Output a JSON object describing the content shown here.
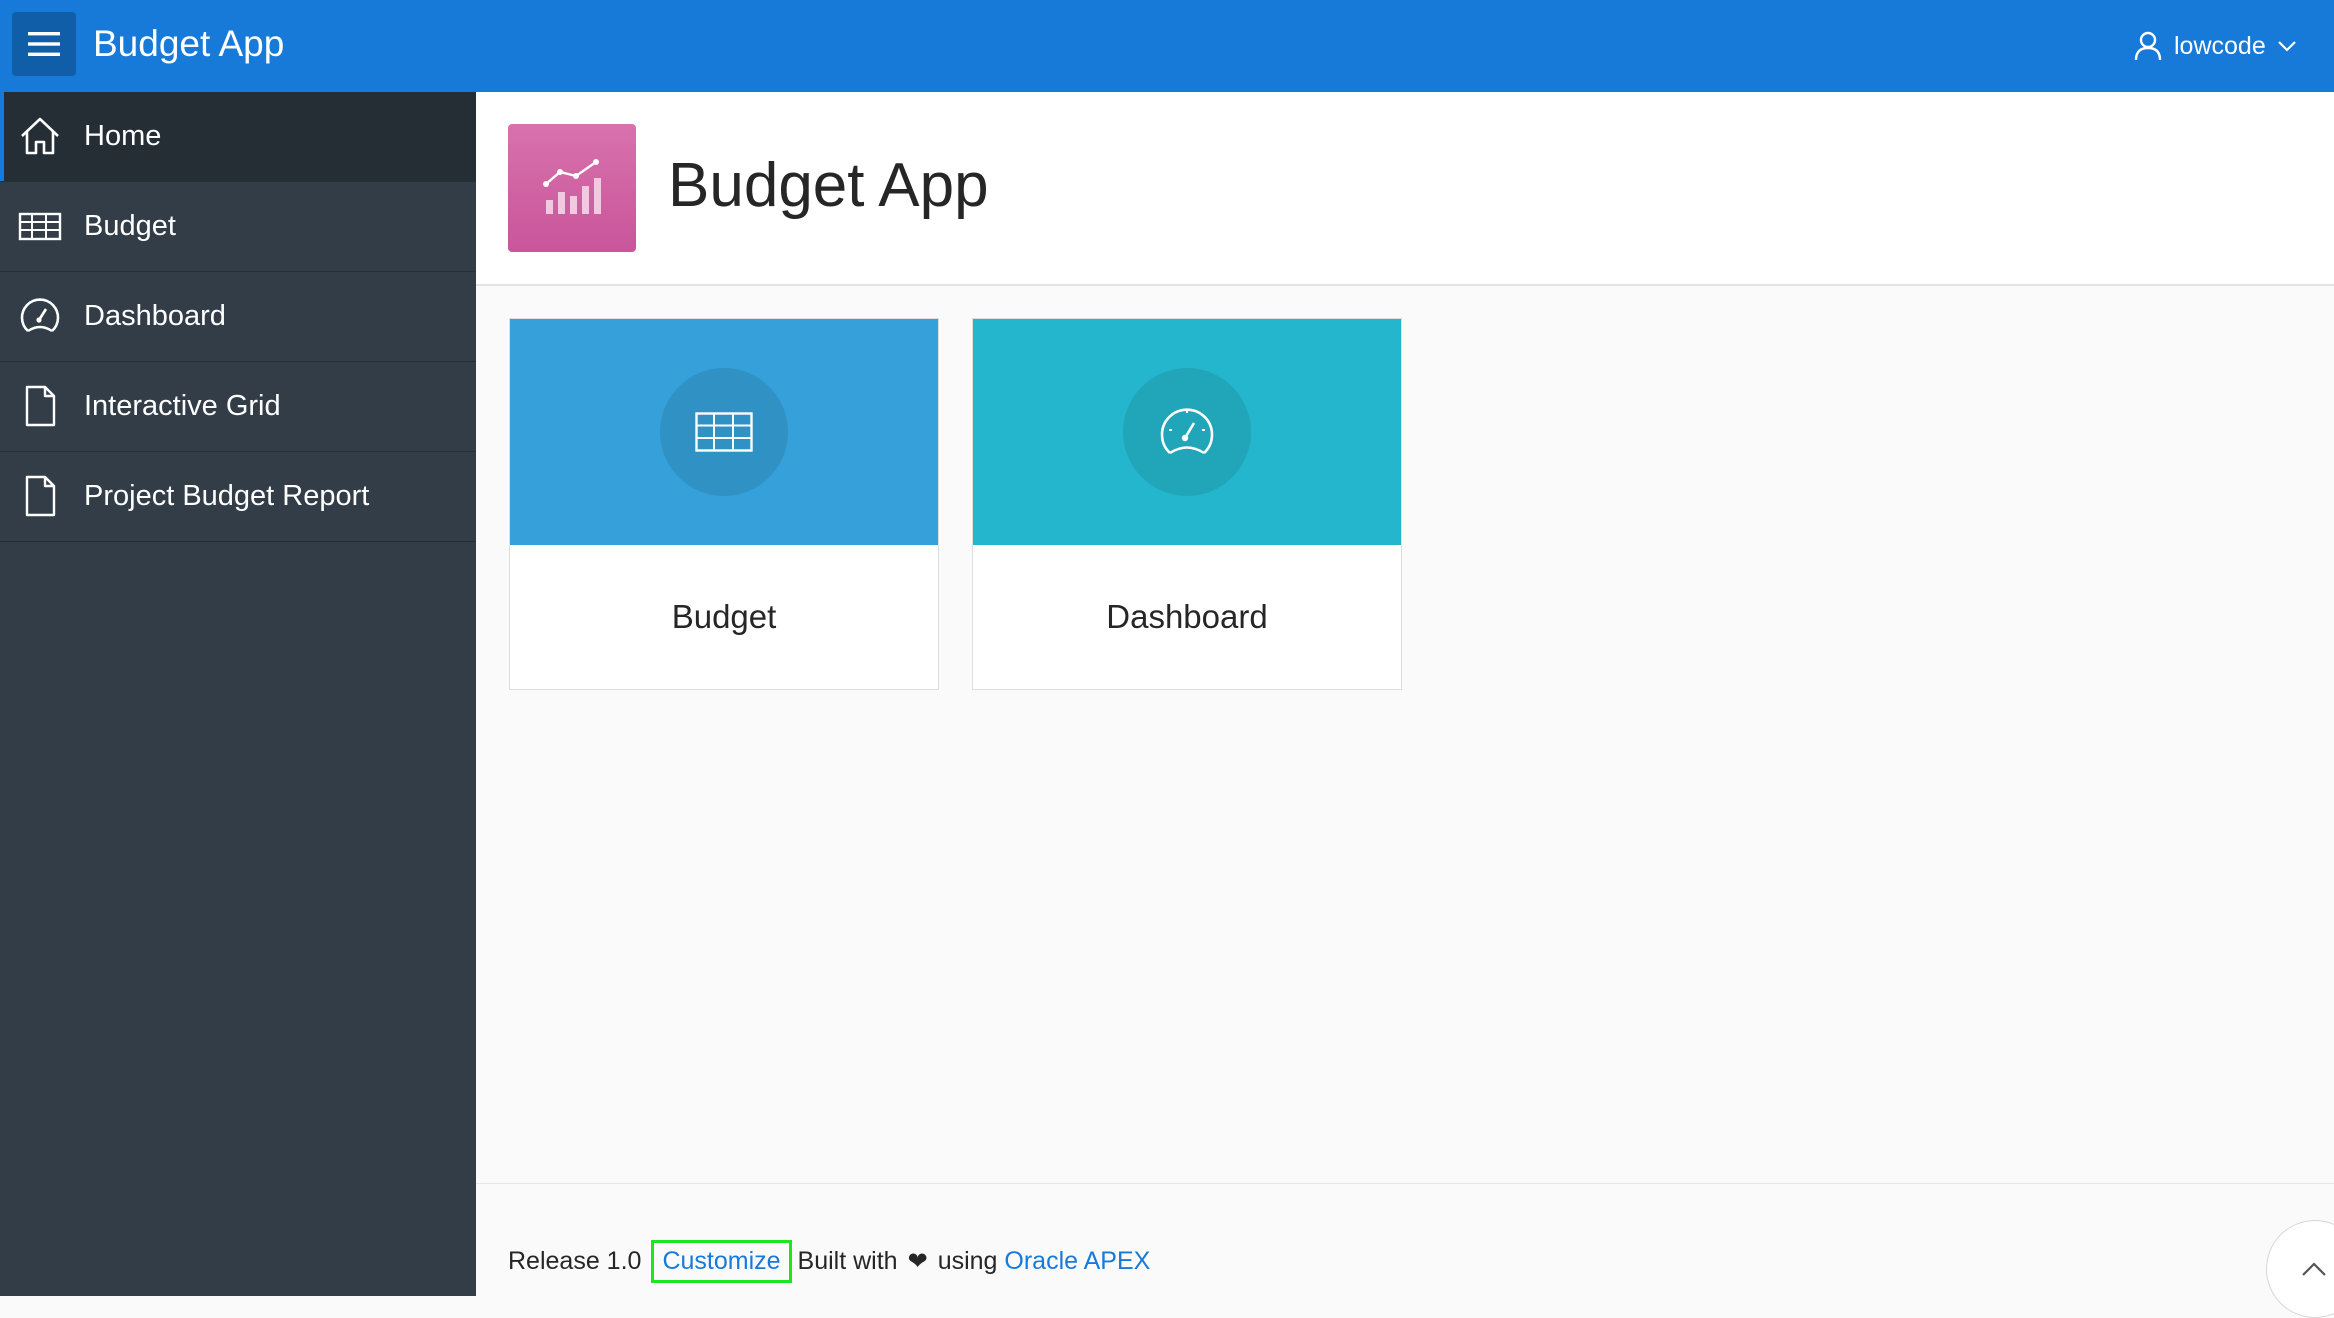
{
  "header": {
    "app_title": "Budget App",
    "username": "lowcode",
    "background": "#177ad9"
  },
  "sidebar": {
    "items": [
      {
        "label": "Home",
        "icon": "home-icon",
        "active": true
      },
      {
        "label": "Budget",
        "icon": "table-icon"
      },
      {
        "label": "Dashboard",
        "icon": "dashboard-icon"
      },
      {
        "label": "Interactive Grid",
        "icon": "file-icon"
      },
      {
        "label": "Project Budget Report",
        "icon": "file-icon"
      }
    ],
    "background": "#323d48"
  },
  "hero": {
    "title": "Budget App",
    "icon": "bar-chart-trend-icon",
    "icon_color": "#cf63a3"
  },
  "cards": [
    {
      "label": "Budget",
      "icon": "table-icon",
      "color": "#35a0d9"
    },
    {
      "label": "Dashboard",
      "icon": "dashboard-icon",
      "color": "#24b6cc"
    }
  ],
  "footer": {
    "release": "Release 1.0",
    "customize": "Customize",
    "built_with": "Built with",
    "using": "using",
    "apex_link": "Oracle APEX"
  }
}
